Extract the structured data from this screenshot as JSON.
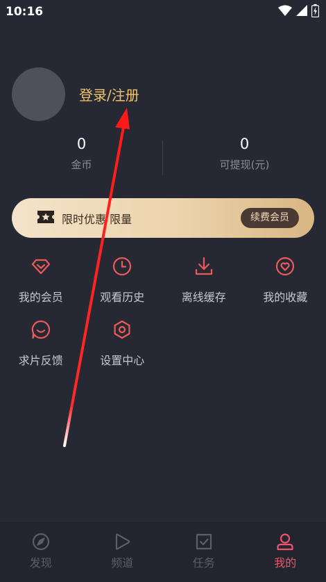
{
  "status_bar": {
    "time": "10:16"
  },
  "profile": {
    "login_label": "登录/注册"
  },
  "stats": [
    {
      "value": "0",
      "label": "金币"
    },
    {
      "value": "0",
      "label": "可提现(元)"
    }
  ],
  "vip_banner": {
    "text": "限时优惠 限量",
    "button_label": "续费会员"
  },
  "grid": [
    {
      "label": "我的会员",
      "icon": "diamond-icon"
    },
    {
      "label": "观看历史",
      "icon": "clock-icon"
    },
    {
      "label": "离线缓存",
      "icon": "download-icon"
    },
    {
      "label": "我的收藏",
      "icon": "heart-icon"
    },
    {
      "label": "求片反馈",
      "icon": "feedback-icon"
    },
    {
      "label": "设置中心",
      "icon": "settings-icon"
    }
  ],
  "bottom_nav": [
    {
      "label": "发现",
      "icon": "compass-icon",
      "active": false
    },
    {
      "label": "频道",
      "icon": "play-icon",
      "active": false
    },
    {
      "label": "任务",
      "icon": "task-icon",
      "active": false
    },
    {
      "label": "我的",
      "icon": "user-icon",
      "active": true
    }
  ],
  "colors": {
    "background": "#262834",
    "accent_gold": "#f0c46a",
    "icon_red": "#ec5a5a",
    "nav_active": "#f0536b",
    "nav_inactive": "#5d5f68"
  }
}
